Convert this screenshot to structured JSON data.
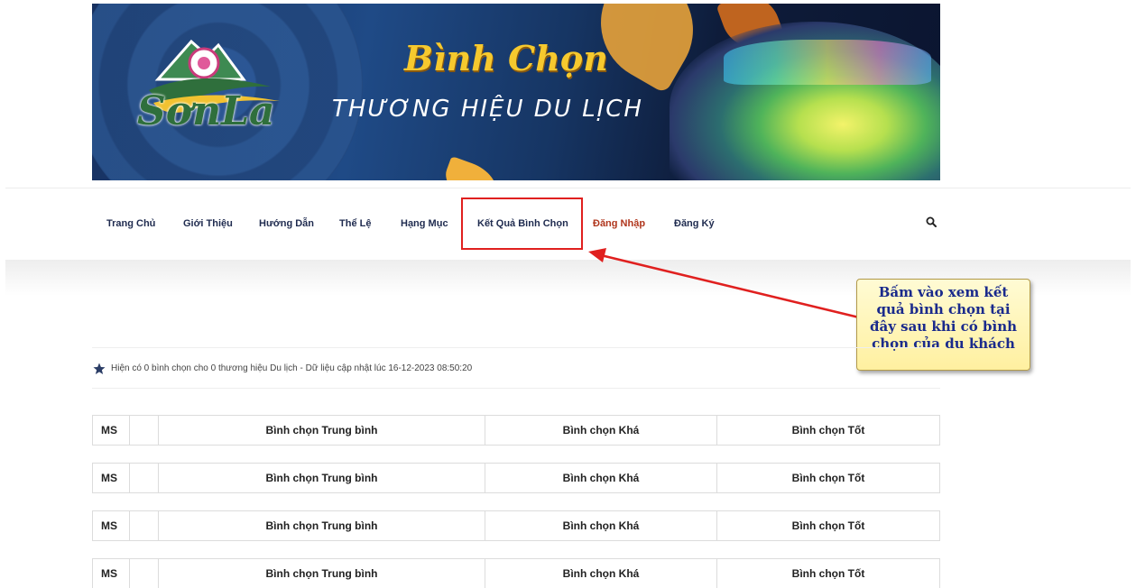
{
  "banner": {
    "logo_text": "SơnLa",
    "title_main": "Bình Chọn",
    "title_sub": "THƯƠNG HIỆU DU LỊCH"
  },
  "nav": {
    "items": [
      {
        "label": "Trang Chủ"
      },
      {
        "label": "Giới Thiệu"
      },
      {
        "label": "Hướng Dẫn"
      },
      {
        "label": "Thể Lệ"
      },
      {
        "label": "Hạng Mục"
      },
      {
        "label": "Kết Quả Bình Chọn"
      },
      {
        "label": "Đăng Nhập"
      },
      {
        "label": "Đăng Ký"
      }
    ],
    "search_icon": "search-icon",
    "highlight_color": "#e0201f",
    "login_color": "#b0361d"
  },
  "callout": {
    "lines": [
      "Bấm vào xem kết",
      "quả bình chọn tại",
      "đây sau khi có bình",
      "chọn của du khách"
    ]
  },
  "info": {
    "icon": "star-icon",
    "text": "Hiện có 0 bình chọn cho 0 thương hiệu Du lịch - Dữ liệu cập nhật lúc 16-12-2023 08:50:20"
  },
  "tables": [
    {
      "ms": "MS",
      "tb": "Bình chọn Trung bình",
      "kha": "Bình chọn Khá",
      "tot": "Bình chọn Tốt"
    },
    {
      "ms": "MS",
      "tb": "Bình chọn Trung bình",
      "kha": "Bình chọn Khá",
      "tot": "Bình chọn Tốt"
    },
    {
      "ms": "MS",
      "tb": "Bình chọn Trung bình",
      "kha": "Bình chọn Khá",
      "tot": "Bình chọn Tốt"
    },
    {
      "ms": "MS",
      "tb": "Bình chọn Trung bình",
      "kha": "Bình chọn Khá",
      "tot": "Bình chọn Tốt"
    }
  ]
}
